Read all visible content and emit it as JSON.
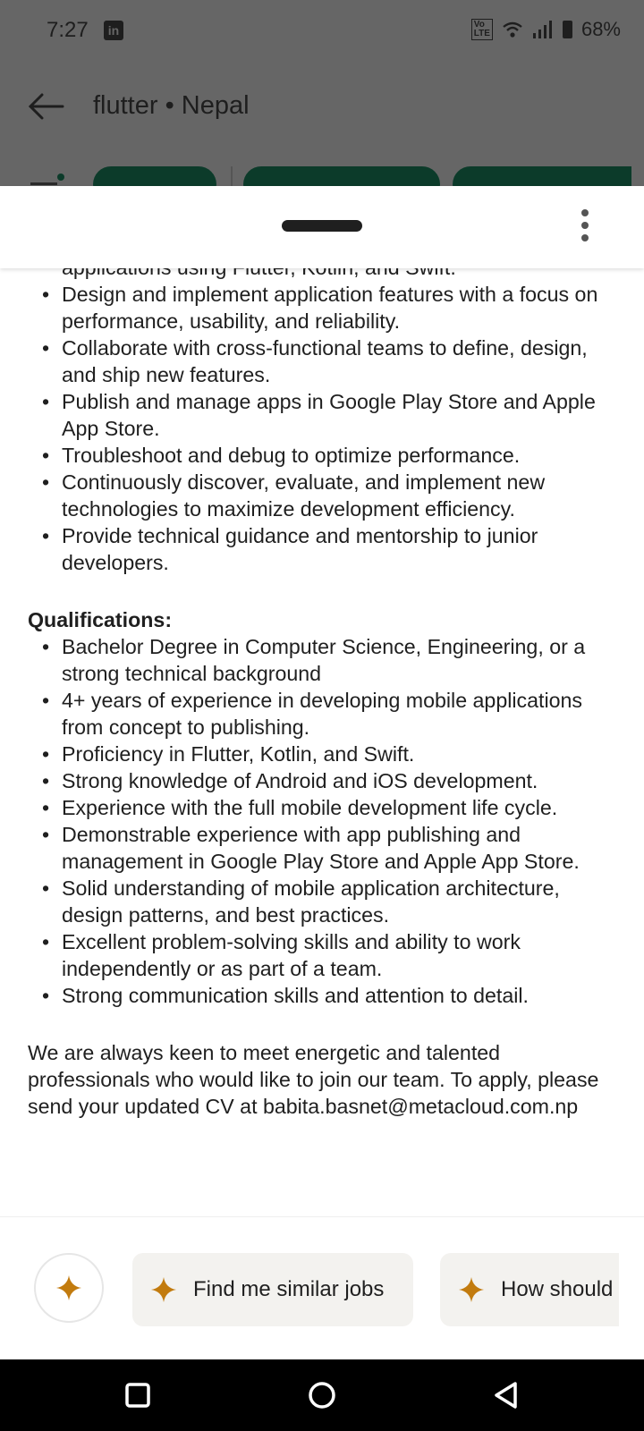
{
  "status_bar": {
    "time": "7:27",
    "app_icon": "linkedin-icon",
    "network_badge": "Vo LTE",
    "battery": "68%"
  },
  "search": {
    "title": "flutter • Nepal"
  },
  "responsibilities_tail": [
    "applications using Flutter, Kotlin, and Swift.",
    "Design and implement application features with a focus on performance, usability, and reliability.",
    "Collaborate with cross-functional teams to define, design, and ship new features.",
    "Publish and manage apps in Google Play Store and Apple App Store.",
    "Troubleshoot and debug to optimize performance.",
    "Continuously discover, evaluate, and implement new technologies to maximize development efficiency.",
    "Provide technical guidance and mentorship to junior developers."
  ],
  "qualifications": {
    "heading": "Qualifications:",
    "items": [
      "Bachelor Degree in Computer Science, Engineering, or a strong technical background",
      "4+ years of experience in developing mobile applications from concept to publishing.",
      "Proficiency in Flutter, Kotlin, and Swift.",
      "Strong knowledge of Android and iOS development.",
      "Experience with the full mobile development life cycle.",
      "Demonstrable experience with app publishing and management in Google Play Store and Apple App Store.",
      "Solid understanding of mobile application architecture, design patterns, and best practices.",
      "Excellent problem-solving skills and ability to work independently or as part of a team.",
      "Strong communication skills and attention to detail."
    ]
  },
  "closing": {
    "text": "We are always keen to meet energetic and talented professionals who would like to join our team. To apply, please send your updated CV at babita.basnet@metacloud.com.np"
  },
  "ai_suggestions": {
    "items": [
      "Find me similar jobs",
      "How should"
    ]
  },
  "colors": {
    "accent_sparkle": "#c27b0e",
    "chip_green": "#0c3b2a",
    "scrim": "#666666"
  }
}
